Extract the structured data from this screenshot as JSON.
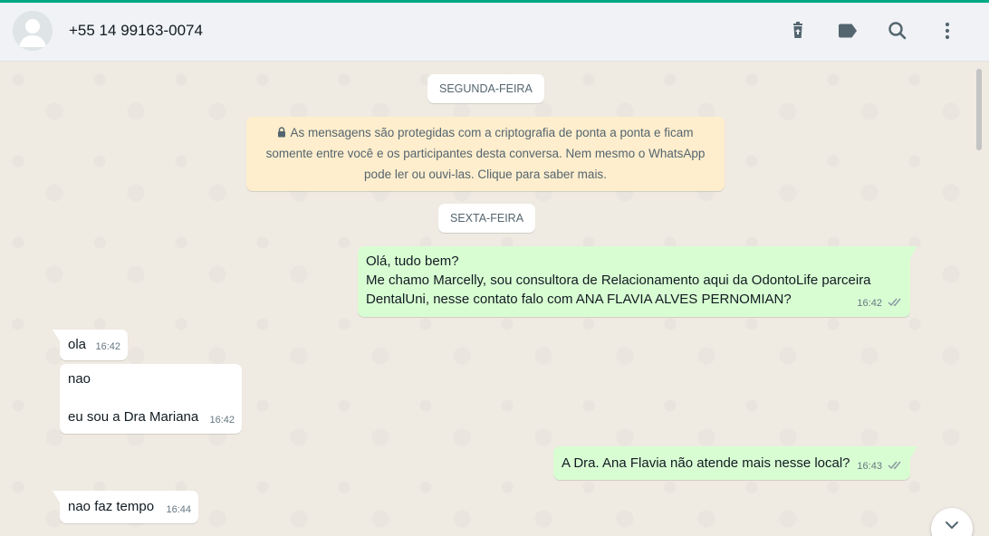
{
  "header": {
    "contact_name": "+55 14 99163-0074",
    "icons": [
      "delete-icon",
      "label-icon",
      "search-icon",
      "menu-icon"
    ]
  },
  "chat": {
    "dates": [
      "SEGUNDA-FEIRA",
      "SEXTA-FEIRA"
    ],
    "encryption_notice": [
      "As mensagens são protegidas com a criptografia de ponta a ponta e ficam",
      "somente entre você e os participantes desta conversa. Nem mesmo o WhatsApp",
      "pode ler ou ouvi-las. Clique para saber mais."
    ],
    "messages": [
      {
        "direction": "outgoing",
        "lines": [
          "Olá, tudo bem?",
          "Me chamo Marcelly, sou consultora de Relacionamento aqui da OdontoLife parceira",
          "DentalUni, nesse contato falo com ANA FLAVIA ALVES PERNOMIAN?"
        ],
        "time": "16:42",
        "status": "read"
      },
      {
        "direction": "incoming",
        "lines": [
          "ola"
        ],
        "time": "16:42"
      },
      {
        "direction": "incoming",
        "lines": [
          "nao",
          "",
          "eu sou a Dra Mariana"
        ],
        "time": "16:42"
      },
      {
        "direction": "outgoing",
        "lines": [
          "A Dra. Ana Flavia não atende mais nesse local?"
        ],
        "time": "16:43",
        "status": "read"
      },
      {
        "direction": "incoming",
        "lines": [
          "nao faz tempo"
        ],
        "time": "16:44"
      }
    ]
  },
  "colors": {
    "accent": "#00a884",
    "outgoing_bubble": "#d9fdd3",
    "incoming_bubble": "#ffffff",
    "notice_bg": "#ffeecd",
    "chat_bg": "#efeae2",
    "read_ticks": "#8696a0"
  }
}
